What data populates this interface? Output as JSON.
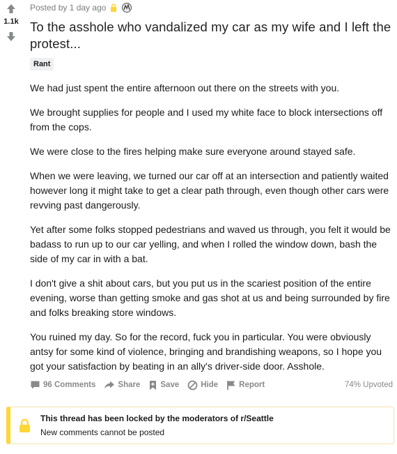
{
  "vote": {
    "score": "1.1k"
  },
  "post": {
    "meta": "Posted by 1 day ago",
    "title": "To the asshole who vandalized my car as my wife and I left the protest...",
    "flair": "Rant",
    "paragraphs": [
      "We had just spent the entire afternoon out there on the streets with you.",
      "We brought supplies for people and I used my white face to block intersections off from the cops.",
      "We were close to the fires helping make sure everyone around stayed safe.",
      "When we were leaving, we turned our car off at an intersection and patiently waited however long it might take to get a clear path through, even though other cars were revving past dangerously.",
      "Yet after some folks stopped pedestrians and waved us through, you felt it would be badass to run up to our car yelling, and when I rolled the window down, bash the side of my car in with a bat.",
      "I don't give a shit about cars, but you put us in the scariest position of the entire evening, worse than getting smoke and gas shot at us and being surrounded by fire and folks breaking store windows.",
      "You ruined my day. So for the record, fuck you in particular. You were obviously antsy for some kind of violence, bringing and brandishing weapons, so I hope you got your satisfaction by beating in an ally's driver-side door. Asshole."
    ]
  },
  "actions": {
    "comments": "96 Comments",
    "share": "Share",
    "save": "Save",
    "hide": "Hide",
    "report": "Report",
    "upvoted": "74% Upvoted"
  },
  "locked": {
    "line1": "This thread has been locked by the moderators of r/Seattle",
    "line2": "New comments cannot be posted"
  },
  "colors": {
    "lock_yellow": "#ffd635",
    "muted_gray": "#878a8c"
  },
  "icons": [
    "upvote-icon",
    "downvote-icon",
    "lock-icon",
    "award-icon",
    "comment-icon",
    "share-icon",
    "save-icon",
    "hide-icon",
    "report-icon"
  ]
}
